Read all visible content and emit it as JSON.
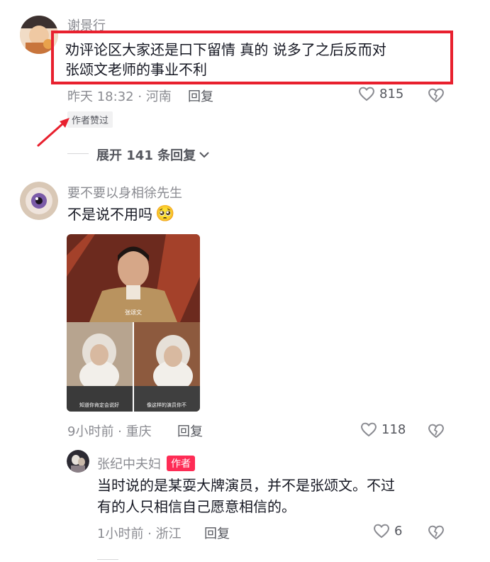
{
  "colors": {
    "annotation": "#e8202e",
    "author_badge": "#fe2c55",
    "meta": "#8a8b91"
  },
  "comment1": {
    "username": "谢景行",
    "text_line1": "劝评论区大家还是口下留情 真的 说多了之后反而对",
    "text_line2": "张颂文老师的事业不利",
    "time_location": "昨天 18:32 · 河南",
    "reply_label": "回复",
    "like_count": "815",
    "author_liked_tag": "作者赞过",
    "expand_label": "展开 141 条回复"
  },
  "comment2": {
    "username": "要不要以身相徐先生",
    "text": "不是说不用吗",
    "emoji": "🥺",
    "image_caption_top": "张颂文",
    "image_caption_left": "知道你肯定会说好",
    "image_caption_right": "像这样的演员你不",
    "time_location": "9小时前 · 重庆",
    "reply_label": "回复",
    "like_count": "118"
  },
  "reply1": {
    "username": "张纪中夫妇",
    "author_badge": "作者",
    "text_line1": "当时说的是某耍大牌演员，并不是张颂文。不过",
    "text_line2": "有的人只相信自己愿意相信的。",
    "time_location": "1小时前 · 浙江",
    "reply_label": "回复",
    "like_count": "6"
  },
  "icons": [
    "heart-icon",
    "dislike-heart-icon",
    "chevron-down-icon",
    "red-arrow-annotation"
  ]
}
